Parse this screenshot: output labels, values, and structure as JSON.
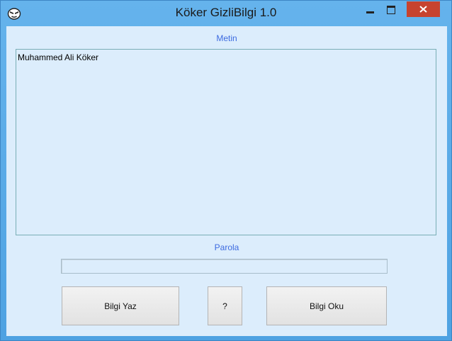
{
  "window": {
    "title": "Köker GizliBilgi 1.0",
    "icon": "mascot-face-icon",
    "controls": [
      "minimize-icon",
      "maximize-icon",
      "close-icon"
    ]
  },
  "content": {
    "metin_label": "Metin",
    "metin_value": "Muhammed Ali Köker",
    "parola_label": "Parola",
    "parola_value": ""
  },
  "buttons": {
    "write_label": "Bilgi Yaz",
    "help_label": "?",
    "read_label": "Bilgi Oku"
  },
  "colors": {
    "title_bar": "#55a8e6",
    "client_bg": "#dcedfc",
    "label_text": "#3d6be0",
    "close_button": "#c7432f"
  }
}
